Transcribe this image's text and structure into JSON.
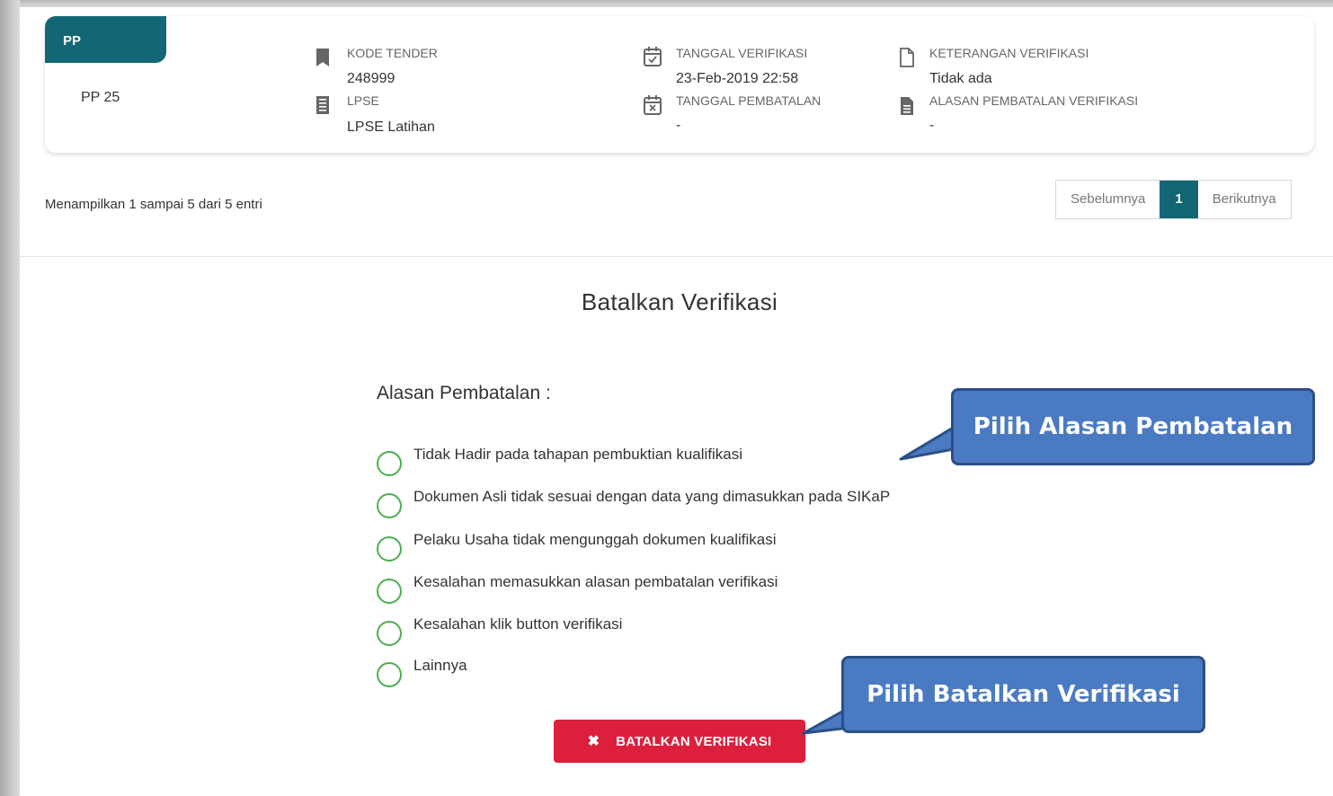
{
  "card": {
    "pp_tab": "PP",
    "pp_name": "PP 25",
    "kode_tender_label": "KODE TENDER",
    "kode_tender_value": "248999",
    "lpse_label": "LPSE",
    "lpse_value": "LPSE Latihan",
    "tanggal_verifikasi_label": "TANGGAL VERIFIKASI",
    "tanggal_verifikasi_value": "23-Feb-2019 22:58",
    "tanggal_pembatalan_label": "TANGGAL PEMBATALAN",
    "tanggal_pembatalan_value": "-",
    "keterangan_label": "KETERANGAN VERIFIKASI",
    "keterangan_value": "Tidak ada",
    "alasan_label": "ALASAN PEMBATALAN VERIFIKASI",
    "alasan_value": "-"
  },
  "table_info": "Menampilkan 1 sampai 5 dari 5 entri",
  "pagination": {
    "prev": "Sebelumnya",
    "current": "1",
    "next": "Berikutnya"
  },
  "form": {
    "title": "Batalkan Verifikasi",
    "reason_label": "Alasan Pembatalan :",
    "reasons": [
      "Tidak Hadir pada tahapan pembuktian kualifikasi",
      "Dokumen Asli tidak sesuai dengan data yang dimasukkan pada SIKaP",
      "Pelaku Usaha tidak mengunggah dokumen kualifikasi",
      "Kesalahan memasukkan alasan pembatalan verifikasi",
      "Kesalahan klik button verifikasi",
      "Lainnya"
    ],
    "submit_label": "BATALKAN VERIFIKASI",
    "submit_icon": "x-icon"
  },
  "callouts": {
    "reason": "Pilih Alasan Pembatalan",
    "submit": "Pilih Batalkan Verifikasi"
  },
  "colors": {
    "primary": "#136675",
    "danger": "#dc1f3c",
    "radio_border": "#4caf50",
    "callout_fill": "#4a7ac2",
    "callout_border": "#2c4f87"
  }
}
